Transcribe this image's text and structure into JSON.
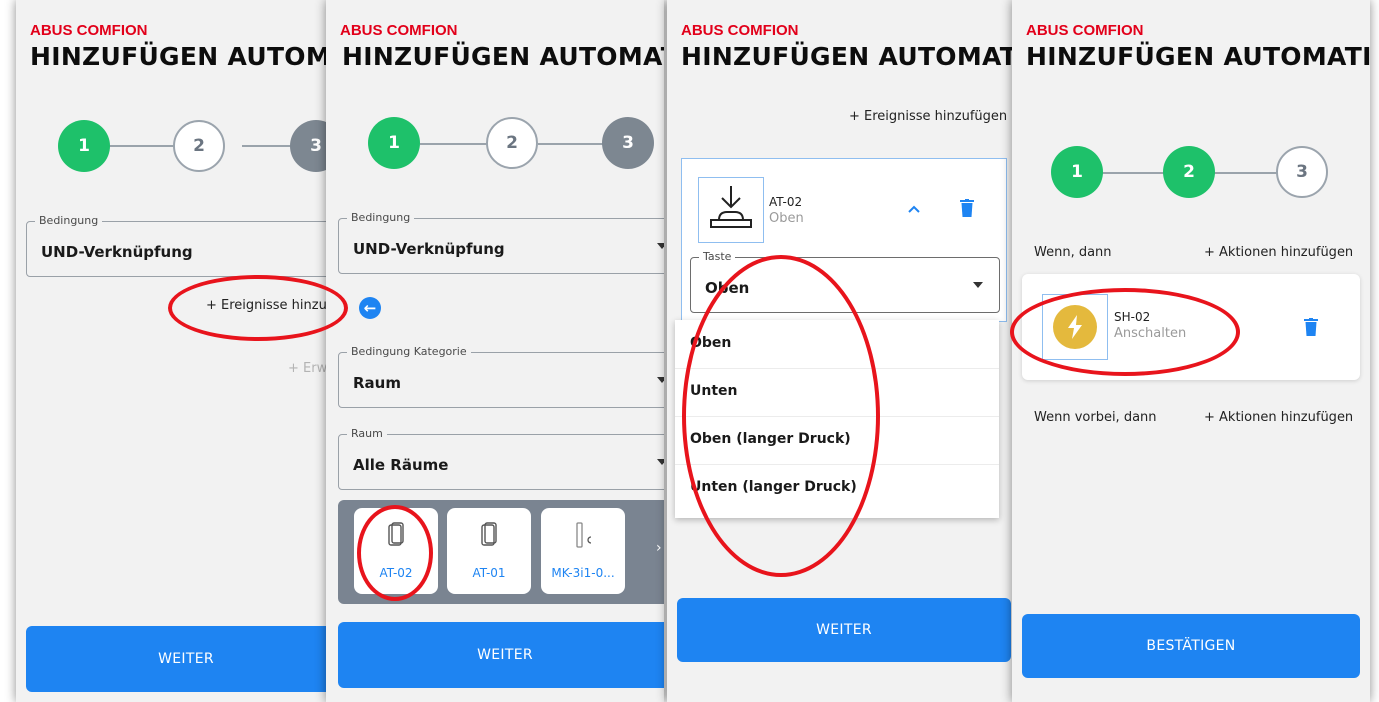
{
  "colors": {
    "brand": "#e2001a",
    "accent": "#1e84f2",
    "step_done": "#1ec16a",
    "step_pending": "#7d8791",
    "annotation": "#e8141c"
  },
  "screens": [
    {
      "brand": "ABUS COMFION",
      "title": "HINZUFÜGEN AUTOMATI",
      "steps": [
        "1",
        "2",
        "3"
      ],
      "condition_label": "Bedingung",
      "condition_value": "UND-Verknüpfung",
      "add_events": "+ Ereignisse hinzuf",
      "advanced": "+ Erw",
      "next_button": "WEITER"
    },
    {
      "brand": "ABUS COMFION",
      "title": "HINZUFÜGEN AUTOMATION",
      "steps": [
        "1",
        "2",
        "3"
      ],
      "condition_label": "Bedingung",
      "condition_value": "UND-Verknüpfung",
      "category_label": "Bedingung Kategorie",
      "category_value": "Raum",
      "room_label": "Raum",
      "room_value": "Alle Räume",
      "devices": [
        "AT-02",
        "AT-01",
        "MK-3i1-0..."
      ],
      "next_button": "WEITER"
    },
    {
      "brand": "ABUS COMFION",
      "title": "HINZUFÜGEN AUTOMATION",
      "add_events": "+ Ereignisse hinzufügen",
      "device_name": "AT-02",
      "device_state": "Oben",
      "key_label": "Taste",
      "key_value": "Oben",
      "options": [
        "Oben",
        "Unten",
        "Oben (langer Druck)",
        "Unten (langer Druck)"
      ],
      "next_button": "WEITER"
    },
    {
      "brand": "ABUS COMFION",
      "title": "HINZUFÜGEN AUTOMATION",
      "steps": [
        "1",
        "2",
        "3"
      ],
      "when_then": "Wenn, dann",
      "add_actions": "+ Aktionen hinzufügen",
      "action_name": "SH-02",
      "action_state": "Anschalten",
      "when_over_then": "Wenn vorbei, dann",
      "add_actions_2": "+ Aktionen hinzufügen",
      "confirm_button": "BESTÄTIGEN"
    }
  ]
}
